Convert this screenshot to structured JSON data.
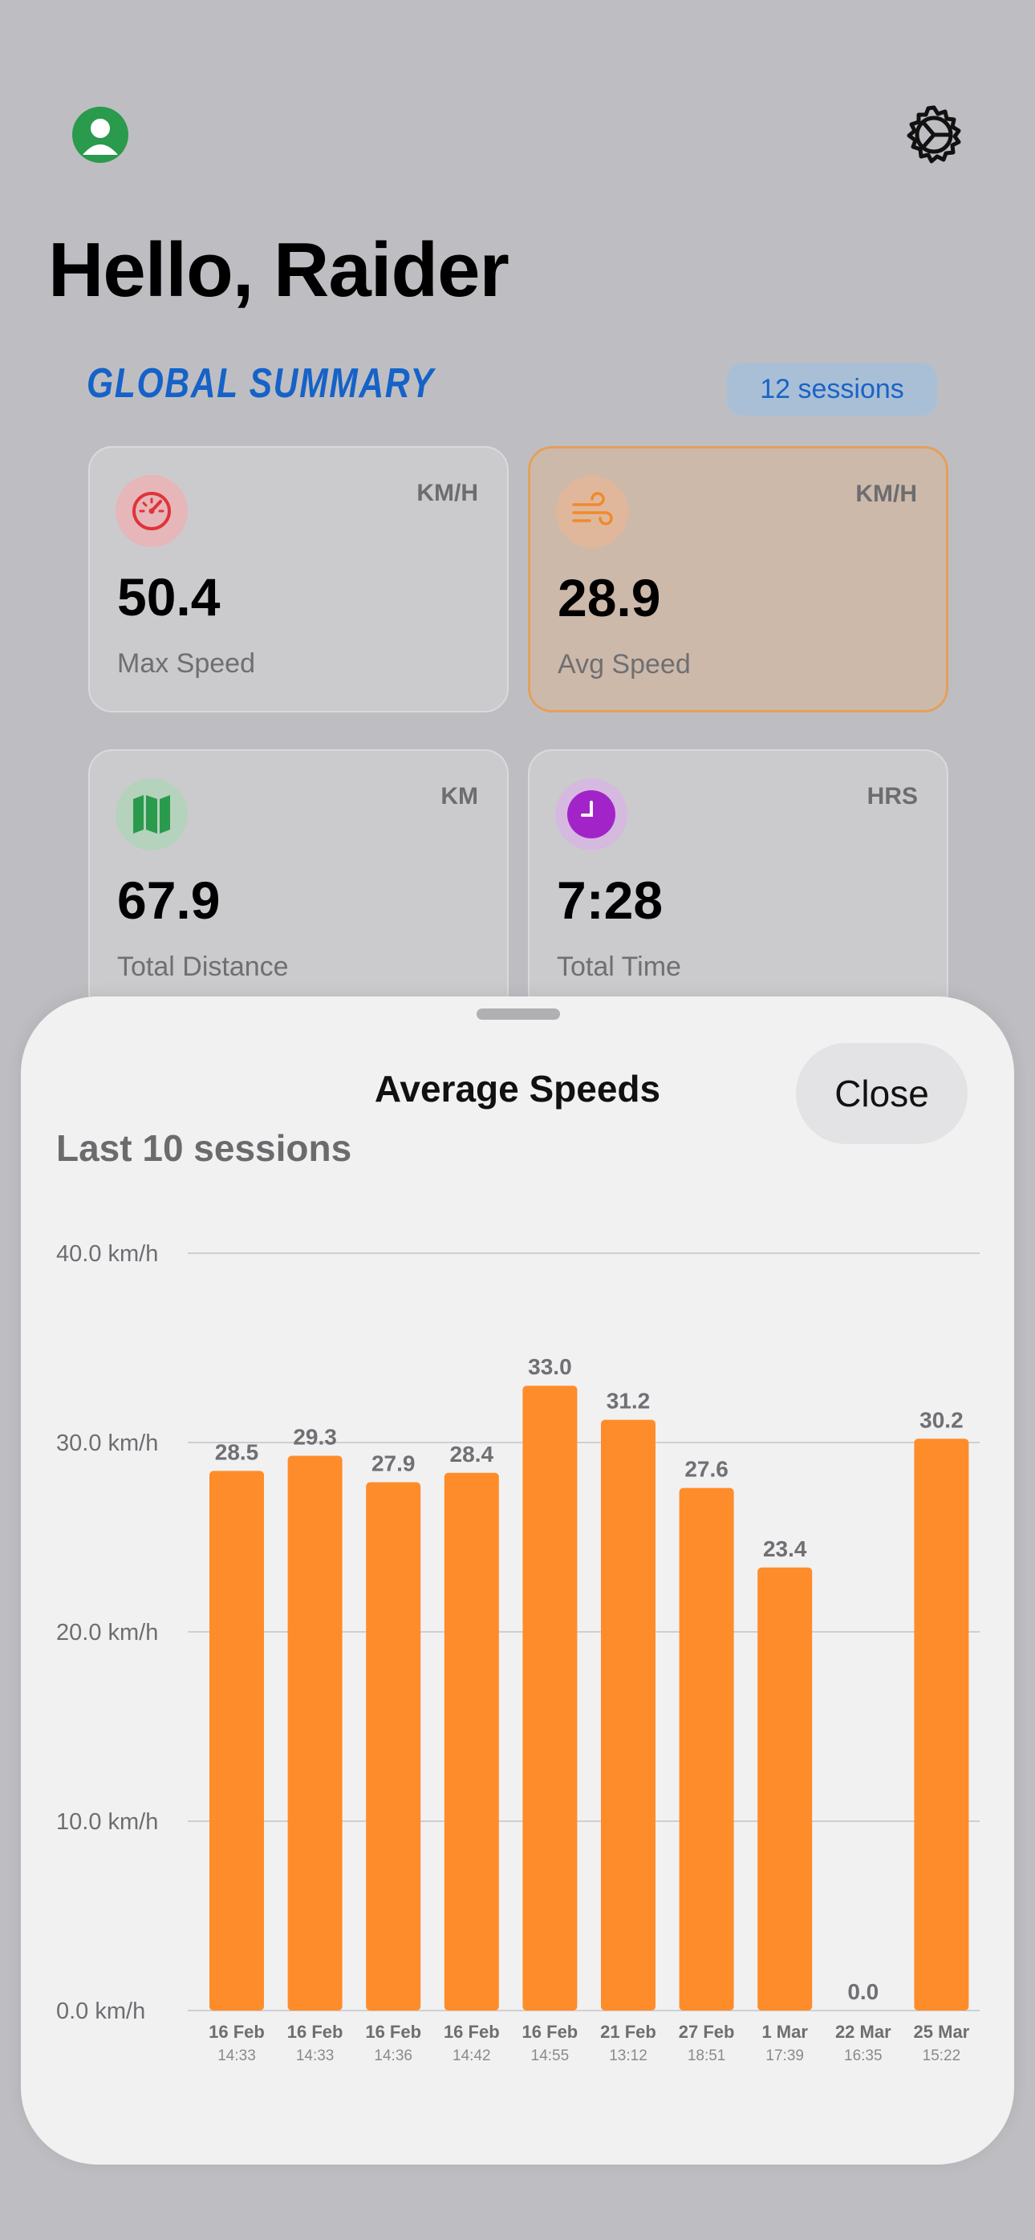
{
  "header": {
    "greeting": "Hello, Raider"
  },
  "summary": {
    "title": "GLOBAL SUMMARY",
    "sessions_badge": "12 sessions",
    "cards": [
      {
        "unit": "KM/H",
        "value": "50.4",
        "label": "Max Speed",
        "icon": "speedometer-icon",
        "color": "#e0333b"
      },
      {
        "unit": "KM/H",
        "value": "28.9",
        "label": "Avg Speed",
        "icon": "wind-icon",
        "color": "#f08a2a",
        "highlighted": true
      },
      {
        "unit": "KM",
        "value": "67.9",
        "label": "Total Distance",
        "icon": "map-icon",
        "color": "#2a9a4d"
      },
      {
        "unit": "HRS",
        "value": "7:28",
        "label": "Total Time",
        "icon": "clock-icon",
        "color": "#a224c9"
      }
    ]
  },
  "sheet": {
    "title": "Average Speeds",
    "close_label": "Close",
    "subtitle": "Last 10 sessions"
  },
  "colors": {
    "bar": "#ff8c2a",
    "accent": "#1562c8"
  },
  "chart_data": {
    "type": "bar",
    "categories": [
      {
        "date": "16 Feb",
        "time": "14:33"
      },
      {
        "date": "16 Feb",
        "time": "14:33"
      },
      {
        "date": "16 Feb",
        "time": "14:36"
      },
      {
        "date": "16 Feb",
        "time": "14:42"
      },
      {
        "date": "16 Feb",
        "time": "14:55"
      },
      {
        "date": "21 Feb",
        "time": "13:12"
      },
      {
        "date": "27 Feb",
        "time": "18:51"
      },
      {
        "date": "1 Mar",
        "time": "17:39"
      },
      {
        "date": "22 Mar",
        "time": "16:35"
      },
      {
        "date": "25 Mar",
        "time": "15:22"
      }
    ],
    "values": [
      28.5,
      29.3,
      27.9,
      28.4,
      33.0,
      31.2,
      27.6,
      23.4,
      0.0,
      30.2
    ],
    "data_labels": [
      "28.5",
      "29.3",
      "27.9",
      "28.4",
      "33.0",
      "31.2",
      "27.6",
      "23.4",
      "0.0",
      "30.2"
    ],
    "y_ticks": [
      0,
      10,
      20,
      30,
      40
    ],
    "y_tick_labels": [
      "0.0 km/h",
      "10.0 km/h",
      "20.0 km/h",
      "30.0 km/h",
      "40.0 km/h"
    ],
    "ylim": [
      0,
      40
    ],
    "grid": true,
    "title": "Average Speeds"
  }
}
